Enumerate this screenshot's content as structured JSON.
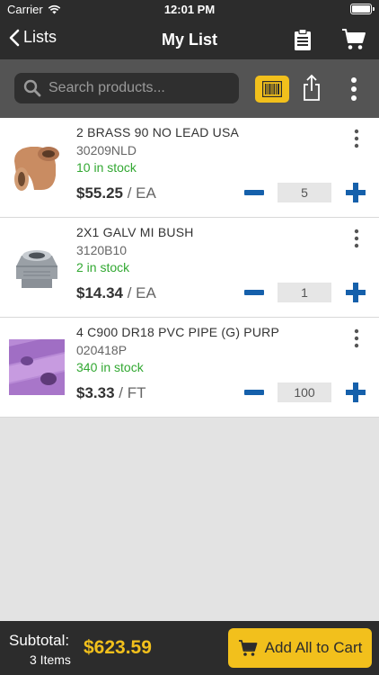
{
  "status_bar": {
    "carrier": "Carrier",
    "time": "12:01 PM"
  },
  "nav": {
    "back_label": "Lists",
    "title": "My List"
  },
  "search": {
    "placeholder": "Search products..."
  },
  "products": [
    {
      "name": "2 BRASS 90 NO LEAD USA",
      "sku": "30209NLD",
      "stock": "10 in stock",
      "price": "$55.25",
      "unit": "/ EA",
      "quantity": "5",
      "thumb": "brass-elbow"
    },
    {
      "name": "2X1 GALV MI BUSH",
      "sku": "3120B10",
      "stock": "2 in stock",
      "price": "$14.34",
      "unit": "/ EA",
      "quantity": "1",
      "thumb": "galv-bushing"
    },
    {
      "name": "4 C900 DR18 PVC PIPE (G) PURP",
      "sku": "020418P",
      "stock": "340 in stock",
      "price": "$3.33",
      "unit": "/ FT",
      "quantity": "100",
      "thumb": "purple-pvc-pipe"
    }
  ],
  "footer": {
    "subtotal_label": "Subtotal:",
    "items_count": "3 Items",
    "subtotal_value": "$623.59",
    "add_all_label": "Add All to Cart"
  },
  "colors": {
    "accent": "#f2c01c",
    "bar": "#2c2c2c",
    "action_blue": "#1560ab",
    "stock_green": "#32a832"
  }
}
